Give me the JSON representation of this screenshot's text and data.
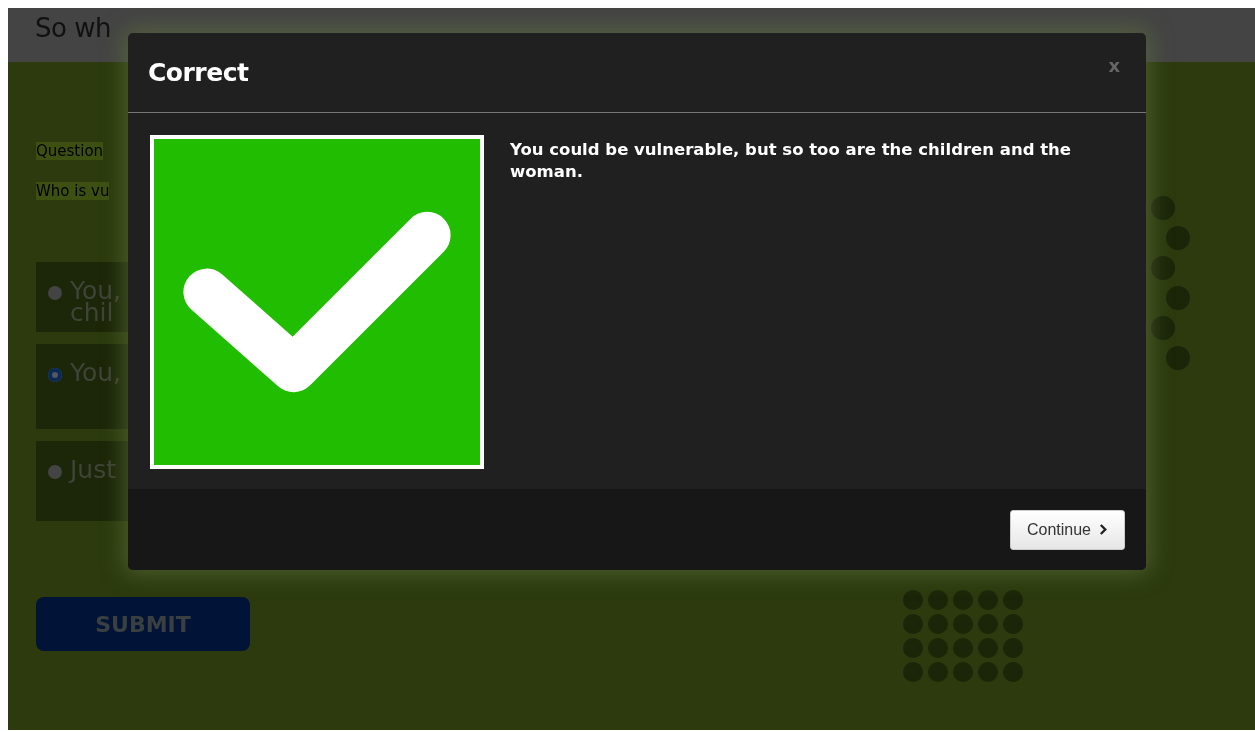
{
  "page": {
    "title": "So wh",
    "question_label": "Question",
    "question": "Who is vu",
    "options": [
      {
        "lines": [
          "You,",
          "chil"
        ],
        "selected": false
      },
      {
        "lines": [
          "You,"
        ],
        "selected": true
      },
      {
        "lines": [
          "Just"
        ],
        "selected": false
      }
    ],
    "submit": "SUBMIT"
  },
  "dialog": {
    "title": "Correct",
    "close": "x",
    "message": "You could be vulnerable, but so too are the children and the woman.",
    "button": "Continue"
  }
}
